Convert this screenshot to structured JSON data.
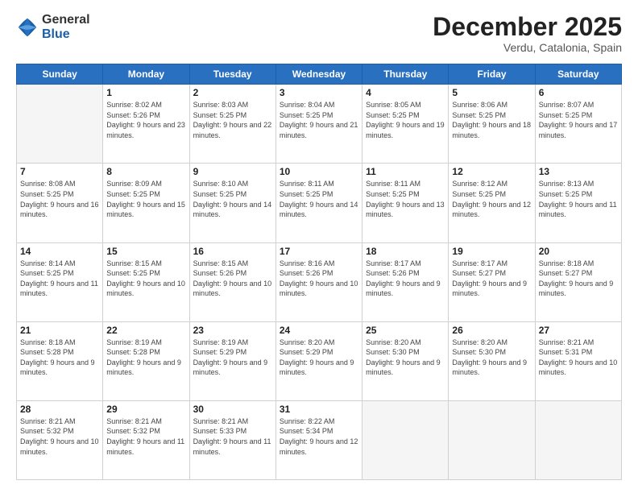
{
  "header": {
    "logo_general": "General",
    "logo_blue": "Blue",
    "month_title": "December 2025",
    "location": "Verdu, Catalonia, Spain"
  },
  "weekdays": [
    "Sunday",
    "Monday",
    "Tuesday",
    "Wednesday",
    "Thursday",
    "Friday",
    "Saturday"
  ],
  "weeks": [
    [
      {
        "day": "",
        "sunrise": "",
        "sunset": "",
        "daylight": ""
      },
      {
        "day": "1",
        "sunrise": "Sunrise: 8:02 AM",
        "sunset": "Sunset: 5:26 PM",
        "daylight": "Daylight: 9 hours and 23 minutes."
      },
      {
        "day": "2",
        "sunrise": "Sunrise: 8:03 AM",
        "sunset": "Sunset: 5:25 PM",
        "daylight": "Daylight: 9 hours and 22 minutes."
      },
      {
        "day": "3",
        "sunrise": "Sunrise: 8:04 AM",
        "sunset": "Sunset: 5:25 PM",
        "daylight": "Daylight: 9 hours and 21 minutes."
      },
      {
        "day": "4",
        "sunrise": "Sunrise: 8:05 AM",
        "sunset": "Sunset: 5:25 PM",
        "daylight": "Daylight: 9 hours and 19 minutes."
      },
      {
        "day": "5",
        "sunrise": "Sunrise: 8:06 AM",
        "sunset": "Sunset: 5:25 PM",
        "daylight": "Daylight: 9 hours and 18 minutes."
      },
      {
        "day": "6",
        "sunrise": "Sunrise: 8:07 AM",
        "sunset": "Sunset: 5:25 PM",
        "daylight": "Daylight: 9 hours and 17 minutes."
      }
    ],
    [
      {
        "day": "7",
        "sunrise": "Sunrise: 8:08 AM",
        "sunset": "Sunset: 5:25 PM",
        "daylight": "Daylight: 9 hours and 16 minutes."
      },
      {
        "day": "8",
        "sunrise": "Sunrise: 8:09 AM",
        "sunset": "Sunset: 5:25 PM",
        "daylight": "Daylight: 9 hours and 15 minutes."
      },
      {
        "day": "9",
        "sunrise": "Sunrise: 8:10 AM",
        "sunset": "Sunset: 5:25 PM",
        "daylight": "Daylight: 9 hours and 14 minutes."
      },
      {
        "day": "10",
        "sunrise": "Sunrise: 8:11 AM",
        "sunset": "Sunset: 5:25 PM",
        "daylight": "Daylight: 9 hours and 14 minutes."
      },
      {
        "day": "11",
        "sunrise": "Sunrise: 8:11 AM",
        "sunset": "Sunset: 5:25 PM",
        "daylight": "Daylight: 9 hours and 13 minutes."
      },
      {
        "day": "12",
        "sunrise": "Sunrise: 8:12 AM",
        "sunset": "Sunset: 5:25 PM",
        "daylight": "Daylight: 9 hours and 12 minutes."
      },
      {
        "day": "13",
        "sunrise": "Sunrise: 8:13 AM",
        "sunset": "Sunset: 5:25 PM",
        "daylight": "Daylight: 9 hours and 11 minutes."
      }
    ],
    [
      {
        "day": "14",
        "sunrise": "Sunrise: 8:14 AM",
        "sunset": "Sunset: 5:25 PM",
        "daylight": "Daylight: 9 hours and 11 minutes."
      },
      {
        "day": "15",
        "sunrise": "Sunrise: 8:15 AM",
        "sunset": "Sunset: 5:25 PM",
        "daylight": "Daylight: 9 hours and 10 minutes."
      },
      {
        "day": "16",
        "sunrise": "Sunrise: 8:15 AM",
        "sunset": "Sunset: 5:26 PM",
        "daylight": "Daylight: 9 hours and 10 minutes."
      },
      {
        "day": "17",
        "sunrise": "Sunrise: 8:16 AM",
        "sunset": "Sunset: 5:26 PM",
        "daylight": "Daylight: 9 hours and 10 minutes."
      },
      {
        "day": "18",
        "sunrise": "Sunrise: 8:17 AM",
        "sunset": "Sunset: 5:26 PM",
        "daylight": "Daylight: 9 hours and 9 minutes."
      },
      {
        "day": "19",
        "sunrise": "Sunrise: 8:17 AM",
        "sunset": "Sunset: 5:27 PM",
        "daylight": "Daylight: 9 hours and 9 minutes."
      },
      {
        "day": "20",
        "sunrise": "Sunrise: 8:18 AM",
        "sunset": "Sunset: 5:27 PM",
        "daylight": "Daylight: 9 hours and 9 minutes."
      }
    ],
    [
      {
        "day": "21",
        "sunrise": "Sunrise: 8:18 AM",
        "sunset": "Sunset: 5:28 PM",
        "daylight": "Daylight: 9 hours and 9 minutes."
      },
      {
        "day": "22",
        "sunrise": "Sunrise: 8:19 AM",
        "sunset": "Sunset: 5:28 PM",
        "daylight": "Daylight: 9 hours and 9 minutes."
      },
      {
        "day": "23",
        "sunrise": "Sunrise: 8:19 AM",
        "sunset": "Sunset: 5:29 PM",
        "daylight": "Daylight: 9 hours and 9 minutes."
      },
      {
        "day": "24",
        "sunrise": "Sunrise: 8:20 AM",
        "sunset": "Sunset: 5:29 PM",
        "daylight": "Daylight: 9 hours and 9 minutes."
      },
      {
        "day": "25",
        "sunrise": "Sunrise: 8:20 AM",
        "sunset": "Sunset: 5:30 PM",
        "daylight": "Daylight: 9 hours and 9 minutes."
      },
      {
        "day": "26",
        "sunrise": "Sunrise: 8:20 AM",
        "sunset": "Sunset: 5:30 PM",
        "daylight": "Daylight: 9 hours and 9 minutes."
      },
      {
        "day": "27",
        "sunrise": "Sunrise: 8:21 AM",
        "sunset": "Sunset: 5:31 PM",
        "daylight": "Daylight: 9 hours and 10 minutes."
      }
    ],
    [
      {
        "day": "28",
        "sunrise": "Sunrise: 8:21 AM",
        "sunset": "Sunset: 5:32 PM",
        "daylight": "Daylight: 9 hours and 10 minutes."
      },
      {
        "day": "29",
        "sunrise": "Sunrise: 8:21 AM",
        "sunset": "Sunset: 5:32 PM",
        "daylight": "Daylight: 9 hours and 11 minutes."
      },
      {
        "day": "30",
        "sunrise": "Sunrise: 8:21 AM",
        "sunset": "Sunset: 5:33 PM",
        "daylight": "Daylight: 9 hours and 11 minutes."
      },
      {
        "day": "31",
        "sunrise": "Sunrise: 8:22 AM",
        "sunset": "Sunset: 5:34 PM",
        "daylight": "Daylight: 9 hours and 12 minutes."
      },
      {
        "day": "",
        "sunrise": "",
        "sunset": "",
        "daylight": ""
      },
      {
        "day": "",
        "sunrise": "",
        "sunset": "",
        "daylight": ""
      },
      {
        "day": "",
        "sunrise": "",
        "sunset": "",
        "daylight": ""
      }
    ]
  ]
}
